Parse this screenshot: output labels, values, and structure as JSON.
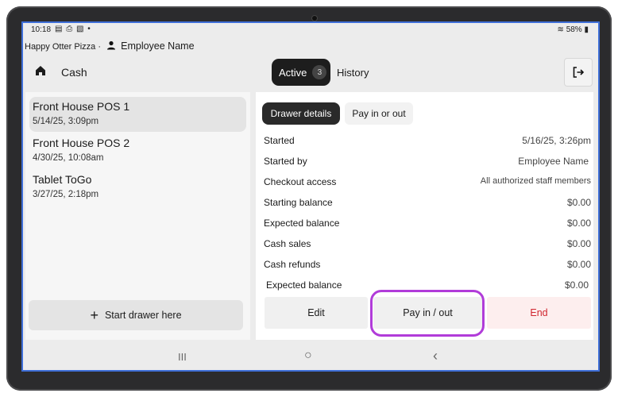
{
  "status_bar": {
    "time": "10:18",
    "notifications": "▤ ⎙ ▧ •",
    "battery": "58%"
  },
  "app": {
    "business_name": "Happy Otter Pizza",
    "separator": "·",
    "employee_name": "Employee Name"
  },
  "header": {
    "title": "Cash",
    "tabs": {
      "active_label": "Active",
      "active_count": "3",
      "history_label": "History"
    }
  },
  "drawers": [
    {
      "name": "Front House POS 1",
      "date": "5/14/25, 3:09pm",
      "selected": true
    },
    {
      "name": "Front House POS 2",
      "date": "4/30/25, 10:08am",
      "selected": false
    },
    {
      "name": "Tablet ToGo",
      "date": "3/27/25, 2:18pm",
      "selected": false
    }
  ],
  "start_drawer_label": "Start drawer here",
  "details": {
    "tabs": {
      "drawer_details": "Drawer details",
      "pay_in_out": "Pay in or out"
    },
    "rows": [
      {
        "label": "Started",
        "value": "5/16/25, 3:26pm"
      },
      {
        "label": "Started by",
        "value": "Employee Name"
      },
      {
        "label": "Checkout access",
        "value": "All authorized staff members"
      },
      {
        "label": "Starting balance",
        "value": "$0.00"
      },
      {
        "label": "Expected balance",
        "value": "$0.00"
      },
      {
        "label": "Cash sales",
        "value": "$0.00"
      },
      {
        "label": "Cash refunds",
        "value": "$0.00"
      },
      {
        "label": "Expected balance",
        "value": "$0.00"
      }
    ]
  },
  "actions": {
    "edit": "Edit",
    "pay_in_out": "Pay in / out",
    "end": "End"
  },
  "nav": {
    "recents": "III",
    "home": "○",
    "back": "‹"
  },
  "colors": {
    "accent_dark": "#1d1d1d",
    "danger": "#d0262f",
    "highlight": "#b13cd9",
    "screen_border": "#3f6fd8"
  }
}
